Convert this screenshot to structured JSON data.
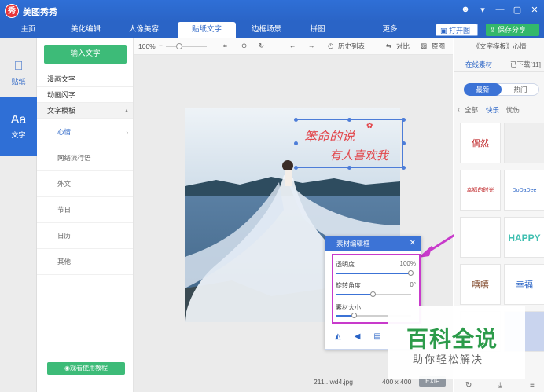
{
  "app": {
    "logo_char": "秀",
    "title": "美图秀秀",
    "window_controls": [
      "☻",
      "▾",
      "—",
      "▢",
      "✕"
    ]
  },
  "nav": {
    "tabs": [
      "主页",
      "美化编辑",
      "人像美容",
      "贴纸文字",
      "边框场景",
      "拼图",
      "更多"
    ],
    "active": "贴纸文字",
    "open_image": "打开图片",
    "save_share": "保存分享"
  },
  "leftbar": {
    "sticker": "贴纸",
    "text": "文字"
  },
  "categories": {
    "add_text": "输入文字",
    "items": [
      "漫画文字",
      "动画闪字",
      "文字模板"
    ],
    "expanded": "文字模板",
    "subitems": [
      "心情",
      "网络流行语",
      "外文",
      "节日",
      "日历",
      "其他"
    ],
    "active_subitem": "心情",
    "tutorial": "观看使用教程"
  },
  "toolbar": {
    "zoom": "100%",
    "history": "历史列表",
    "compare": "对比",
    "original": "原图"
  },
  "canvas": {
    "sticker_line1": "笨命的说",
    "sticker_line2": "有人喜欢我",
    "file_name": "211...wd4.jpg",
    "image_size": "400 x 400",
    "exif": "EXIF"
  },
  "editor": {
    "title": "素材编辑框",
    "opacity_label": "透明度",
    "opacity_value": "100%",
    "opacity": 1.0,
    "rotation_label": "旋转角度",
    "rotation_value": "0°",
    "rotation": 0.5,
    "size_label": "素材大小",
    "size": 0.25
  },
  "rightpanel": {
    "breadcrumb": "《文字模板》心情",
    "tab_online": "在线素材",
    "tab_downloaded": "已下载[11]",
    "pill_latest": "最新",
    "pill_hot": "热门",
    "sub_all": "全部",
    "sub_happy": "快乐",
    "sub_sad": "忧伤",
    "thumbs": [
      "偶然",
      "",
      "幸福的时光",
      "DoDaDee",
      "",
      "HAPPY",
      "嘻嘻",
      "幸福",
      "",
      "",
      "",
      ""
    ]
  },
  "watermark": {
    "main": "百科全说",
    "sub": "助你轻松解决"
  },
  "colors": {
    "brand_blue": "#2a64c6",
    "green": "#3dbb78",
    "sticker_red": "#e2464b",
    "highlight_magenta": "#c83acb"
  }
}
